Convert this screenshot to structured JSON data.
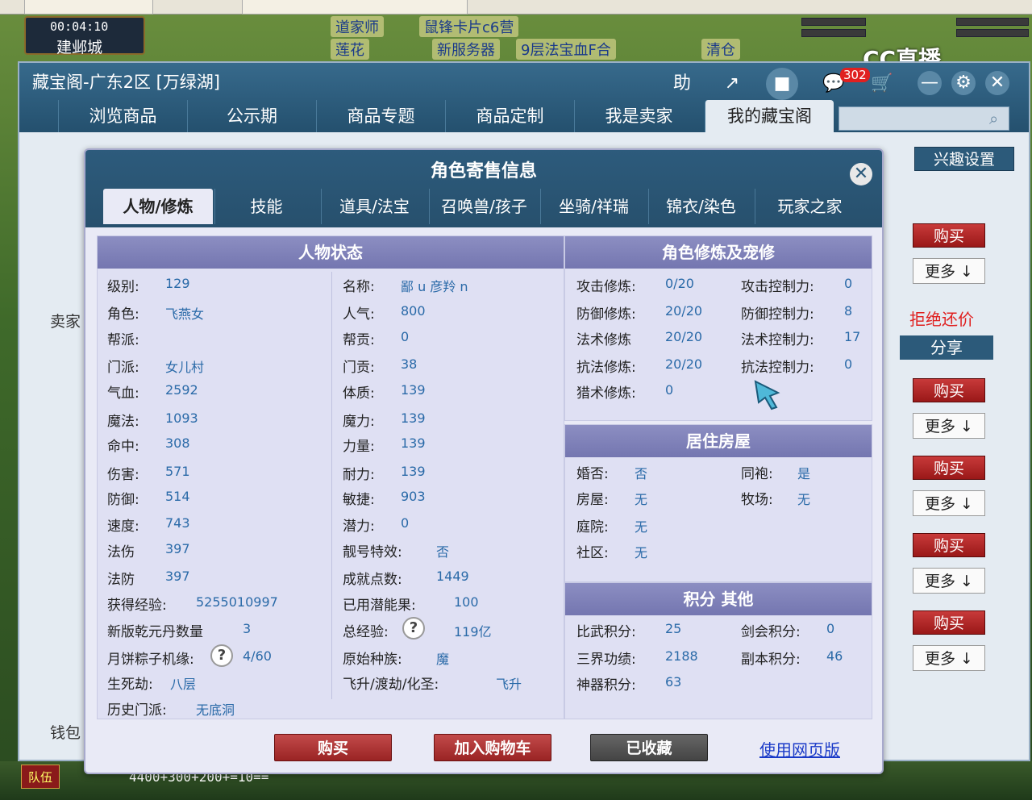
{
  "game": {
    "clock": "00:04:10",
    "city": "建邺城",
    "scroll_texts": [
      "道家师",
      "鼠锋卡片c6营",
      "莲花",
      "新服务器",
      "9层法宝血F合",
      "清仓"
    ],
    "chat_input": "4400+300+200+=10==",
    "team_label": "队伍",
    "badge_count": "302",
    "stream_logo": "CC直播"
  },
  "main": {
    "title": "藏宝阁-广东2区 [万绿湖]",
    "nav": [
      "浏览商品",
      "公示期",
      "商品专题",
      "商品定制",
      "我是卖家",
      "我的藏宝阁"
    ],
    "active_nav": "我的藏宝阁",
    "interest_btn": "兴趣设置",
    "buy_label": "购买",
    "more_label": "更多 ↓",
    "refuse_bargain": "拒绝还价",
    "share": "分享",
    "seller_label": "卖家",
    "wallet_label": "钱包"
  },
  "dialog": {
    "title": "角色寄售信息",
    "tabs": [
      "人物/修炼",
      "技能",
      "道具/法宝",
      "召唤兽/孩子",
      "坐骑/祥瑞",
      "锦衣/染色",
      "玩家之家"
    ],
    "status_panel": {
      "title": "人物状态",
      "left": [
        {
          "label": "级别:",
          "value": "129"
        },
        {
          "label": "角色:",
          "value": "飞燕女"
        },
        {
          "label": "帮派:",
          "value": ""
        },
        {
          "label": "门派:",
          "value": "女儿村"
        },
        {
          "label": "气血:",
          "value": "2592"
        },
        {
          "label": "魔法:",
          "value": "1093"
        },
        {
          "label": "命中:",
          "value": "308"
        },
        {
          "label": "伤害:",
          "value": "571"
        },
        {
          "label": "防御:",
          "value": "514"
        },
        {
          "label": "速度:",
          "value": "743"
        },
        {
          "label": "法伤",
          "value": "397"
        },
        {
          "label": "法防",
          "value": "397"
        },
        {
          "label": "获得经验:",
          "value": "5255010997"
        },
        {
          "label": "新版乾元丹数量",
          "value": "3"
        },
        {
          "label": "月饼粽子机缘:",
          "value": "4/60"
        },
        {
          "label": "生死劫:",
          "value": "八层"
        },
        {
          "label": "历史门派:",
          "value": "无底洞"
        }
      ],
      "right": [
        {
          "label": "名称:",
          "value": "鄙 u 彦羚 n"
        },
        {
          "label": "人气:",
          "value": "800"
        },
        {
          "label": "帮贡:",
          "value": "0"
        },
        {
          "label": "门贡:",
          "value": "38"
        },
        {
          "label": "体质:",
          "value": "139"
        },
        {
          "label": "魔力:",
          "value": "139"
        },
        {
          "label": "力量:",
          "value": "139"
        },
        {
          "label": "耐力:",
          "value": "139"
        },
        {
          "label": "敏捷:",
          "value": "903"
        },
        {
          "label": "潜力:",
          "value": "0"
        },
        {
          "label": "靓号特效:",
          "value": "否"
        },
        {
          "label": "成就点数:",
          "value": "1449"
        },
        {
          "label": "已用潜能果:",
          "value": "100"
        },
        {
          "label": "总经验:",
          "value": "119亿"
        },
        {
          "label": "原始种族:",
          "value": "魔"
        },
        {
          "label": "飞升/渡劫/化圣:",
          "value": "飞升"
        }
      ]
    },
    "cultivation_panel": {
      "title": "角色修炼及宠修",
      "left": [
        {
          "label": "攻击修炼:",
          "value": "0/20"
        },
        {
          "label": "防御修炼:",
          "value": "20/20"
        },
        {
          "label": "法术修炼",
          "value": "20/20"
        },
        {
          "label": "抗法修炼:",
          "value": "20/20"
        },
        {
          "label": "猎术修炼:",
          "value": "0"
        }
      ],
      "right": [
        {
          "label": "攻击控制力:",
          "value": "0"
        },
        {
          "label": "防御控制力:",
          "value": "8"
        },
        {
          "label": "法术控制力:",
          "value": "17"
        },
        {
          "label": "抗法控制力:",
          "value": "0"
        }
      ]
    },
    "house_panel": {
      "title": "居住房屋",
      "left": [
        {
          "label": "婚否:",
          "value": "否"
        },
        {
          "label": "房屋:",
          "value": "无"
        },
        {
          "label": "庭院:",
          "value": "无"
        },
        {
          "label": "社区:",
          "value": "无"
        }
      ],
      "right": [
        {
          "label": "同袍:",
          "value": "是"
        },
        {
          "label": "牧场:",
          "value": "无"
        }
      ]
    },
    "score_panel": {
      "title": "积分 其他",
      "left": [
        {
          "label": "比武积分:",
          "value": "25"
        },
        {
          "label": "三界功绩:",
          "value": "2188"
        },
        {
          "label": "神器积分:",
          "value": "63"
        }
      ],
      "right": [
        {
          "label": "剑会积分:",
          "value": "0"
        },
        {
          "label": "副本积分:",
          "value": "46"
        }
      ]
    },
    "buttons": {
      "buy": "购买",
      "add_cart": "加入购物车",
      "favorited": "已收藏",
      "web_version": "使用网页版"
    }
  }
}
